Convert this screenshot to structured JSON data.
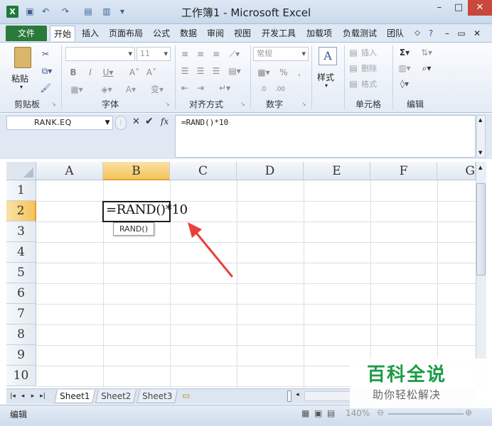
{
  "window": {
    "title": "工作簿1 - Microsoft Excel",
    "controls": [
      "–",
      "□",
      "✕"
    ]
  },
  "ribbon_tabs": [
    "文件",
    "开始",
    "插入",
    "页面布局",
    "公式",
    "数据",
    "审阅",
    "视图",
    "开发工具",
    "加载项",
    "负载测试",
    "团队"
  ],
  "ribbon": {
    "paste_label": "粘贴",
    "font_name": "",
    "font_size": "11",
    "number_format": "常规",
    "style_label": "样式",
    "insert_label": "插入",
    "delete_label": "删除",
    "format_label": "格式",
    "groups": [
      "剪贴板",
      "字体",
      "对齐方式",
      "数字",
      "单元格",
      "编辑"
    ]
  },
  "formula_bar": {
    "name_box": "RANK.EQ",
    "fx_label": "fx",
    "formula": "=RAND()*10"
  },
  "sheet": {
    "columns": [
      "A",
      "B",
      "C",
      "D",
      "E",
      "F",
      "G"
    ],
    "rows": [
      "1",
      "2",
      "3",
      "4",
      "5",
      "6",
      "7",
      "8",
      "9",
      "10"
    ],
    "active_cell_text": "=RAND()*10",
    "tooltip": "RAND()"
  },
  "sheet_tabs": [
    "Sheet1",
    "Sheet2",
    "Sheet3"
  ],
  "status": {
    "mode": "编辑",
    "zoom": "140%"
  },
  "watermark": {
    "title": "百科全说",
    "subtitle": "助你轻松解决"
  },
  "colors": {
    "file_tab": "#2a7a3b",
    "selected_header": "#f5c35c",
    "arrow": "#e8403c",
    "watermark": "#1c9b46"
  }
}
